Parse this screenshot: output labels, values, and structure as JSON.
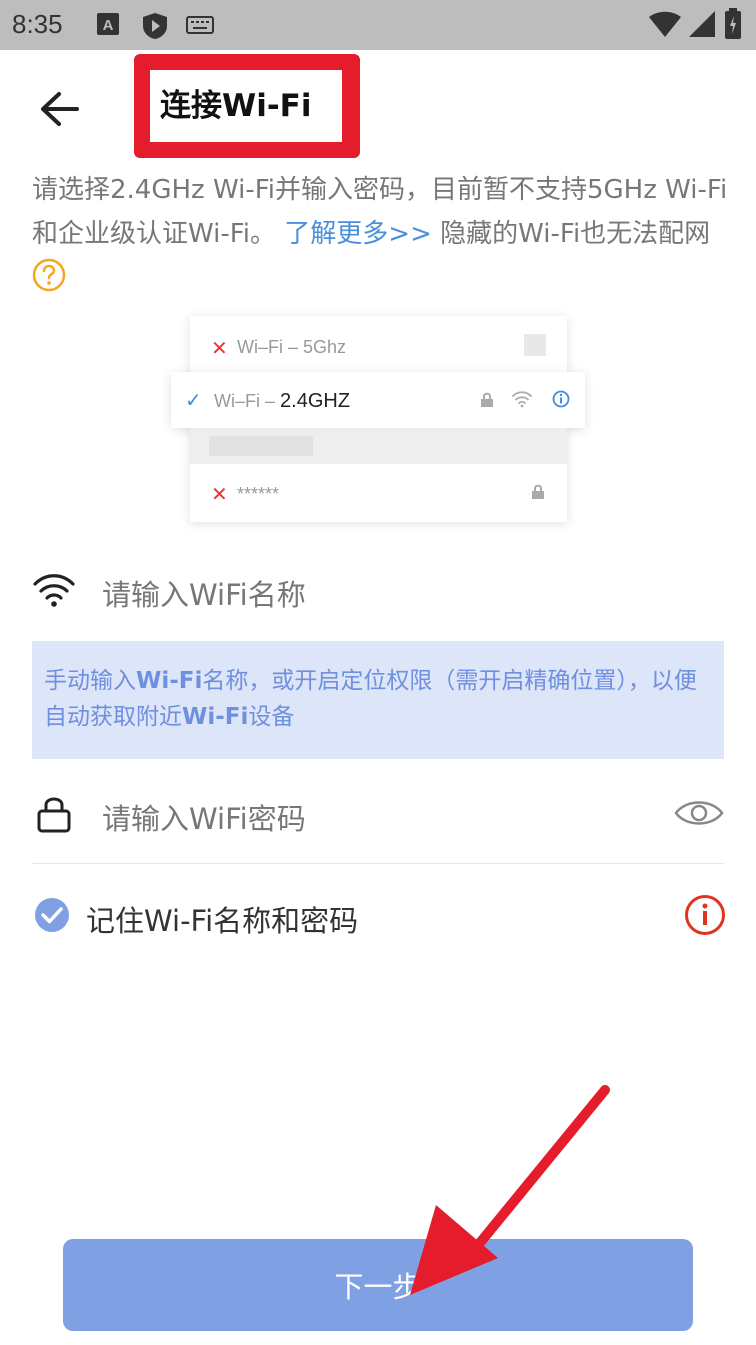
{
  "status_bar": {
    "time": "8:35"
  },
  "header": {
    "title": "连接Wi-Fi"
  },
  "description": {
    "text_before_link": "请选择2.4GHz Wi-Fi并输入密码，目前暂不支持5GHz Wi-Fi和企业级认证Wi-Fi。",
    "link": "了解更多>>",
    "text_after_link": " 隐藏的Wi-Fi也无法配网"
  },
  "illustration": {
    "row1": "Wi–Fi – 5Ghz",
    "row2_prefix": "Wi–Fi – ",
    "row2_strong": "2.4GHZ",
    "row3": "******",
    "row1_mark": "✕",
    "row2_mark": "✓",
    "row3_mark": "✕"
  },
  "wifi_field": {
    "placeholder": "请输入WiFi名称"
  },
  "hint": {
    "p1": "手动输入",
    "b1": "Wi-Fi",
    "p2": "名称，或开启定位权限（需开启精确位置），以便自动获取附近",
    "b2": "Wi-Fi",
    "p3": "设备"
  },
  "password_field": {
    "placeholder": "请输入WiFi密码"
  },
  "remember": {
    "label": "记住Wi-Fi名称和密码",
    "checked": true
  },
  "next_button": {
    "label": "下一步"
  },
  "colors": {
    "accent": "#7fa0e2",
    "link": "#4a8fdc",
    "annotation_red": "#e51c2b",
    "info_red": "#e0341f",
    "hint_bg": "#dde5f8"
  }
}
